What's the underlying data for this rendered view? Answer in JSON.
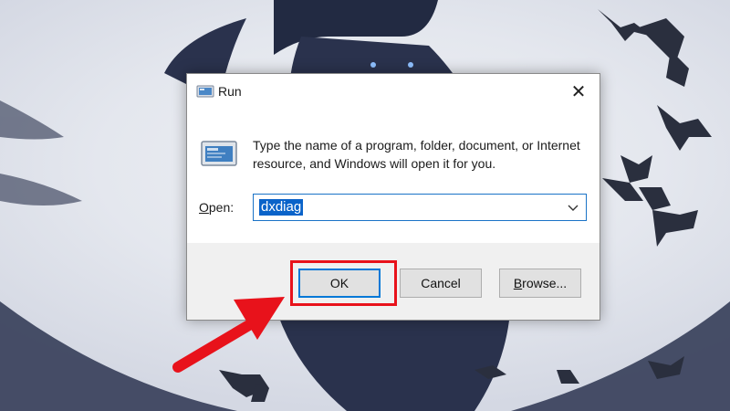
{
  "dialog": {
    "title": "Run",
    "description": "Type the name of a program, folder, document, or Internet resource, and Windows will open it for you.",
    "open_label_prefix": "O",
    "open_label_rest": "pen:",
    "input_value": "dxdiag",
    "close_glyph": "✕"
  },
  "buttons": {
    "ok": "OK",
    "cancel": "Cancel",
    "browse_prefix": "B",
    "browse_rest": "rowse..."
  },
  "colors": {
    "highlight": "#e8121b",
    "selection": "#0a63c9",
    "focus_border": "#0078d7"
  },
  "icons": [
    "run-app-icon",
    "program-icon",
    "close-icon",
    "dropdown-chevron-icon",
    "pointer-arrow-icon"
  ]
}
